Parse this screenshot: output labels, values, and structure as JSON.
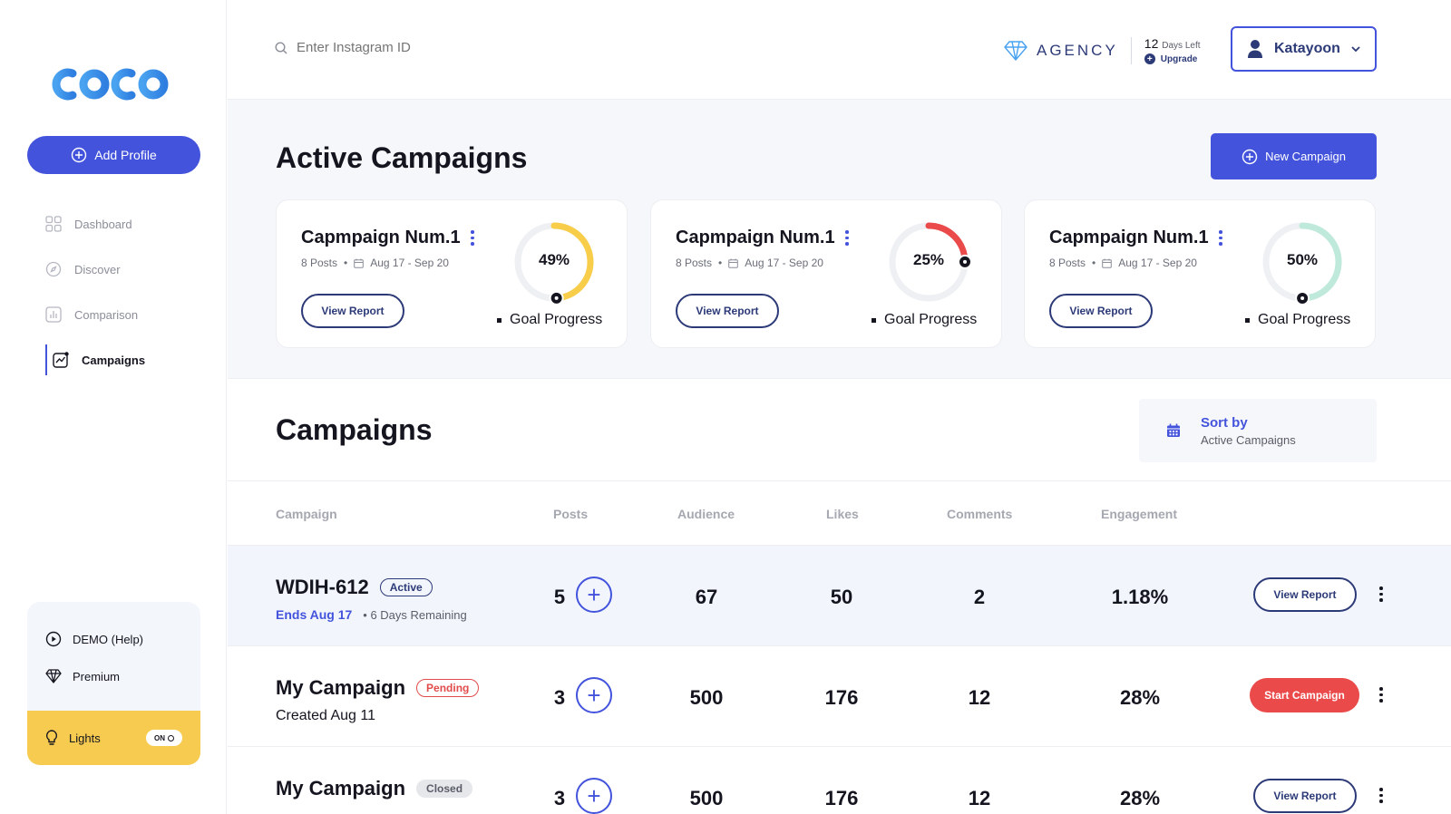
{
  "sidebar": {
    "add_profile_label": "Add Profile",
    "nav": [
      {
        "label": "Dashboard",
        "icon": "grid-icon"
      },
      {
        "label": "Discover",
        "icon": "compass-icon"
      },
      {
        "label": "Comparison",
        "icon": "bar-chart-icon"
      },
      {
        "label": "Campaigns",
        "icon": "campaign-chart-icon"
      }
    ],
    "help": {
      "demo_label": "DEMO (Help)",
      "premium_label": "Premium",
      "lights_label": "Lights",
      "toggle_label": "ON"
    }
  },
  "header": {
    "search_placeholder": "Enter Instagram ID",
    "agency_label": "AGENCY",
    "days_count": "12",
    "days_label": "Days Left",
    "upgrade_label": "Upgrade",
    "user_name": "Katayoon"
  },
  "active": {
    "title": "Active Campaigns",
    "new_campaign_label": "New Campaign",
    "cards": [
      {
        "title": "Capmpaign Num.1",
        "posts": "8 Posts",
        "dates": "Aug 17 - Sep 20",
        "view_label": "View Report",
        "percent_text": "49%",
        "progress": 0.49,
        "color": "#f7cd4a",
        "goal_label": "Goal Progress"
      },
      {
        "title": "Capmpaign Num.1",
        "posts": "8 Posts",
        "dates": "Aug 17 - Sep 20",
        "view_label": "View Report",
        "percent_text": "25%",
        "progress": 0.25,
        "color": "#ea4a4a",
        "goal_label": "Goal Progress"
      },
      {
        "title": "Capmpaign Num.1",
        "posts": "8 Posts",
        "dates": "Aug 17 - Sep 20",
        "view_label": "View Report",
        "percent_text": "50%",
        "progress": 0.5,
        "color": "#bfeadb",
        "goal_label": "Goal Progress"
      }
    ]
  },
  "campaigns": {
    "title": "Campaigns",
    "sort_title": "Sort by",
    "sort_value": "Active Campaigns",
    "columns": [
      "Campaign",
      "Posts",
      "Audience",
      "Likes",
      "Comments",
      "Engagement"
    ],
    "rows": [
      {
        "name": "WDIH-612",
        "status": "Active",
        "ends": "Ends Aug 17",
        "remaining": "6 Days Remaining",
        "posts": "5",
        "audience": "67",
        "likes": "50",
        "comments": "2",
        "engagement": "1.18%",
        "action": "View Report"
      },
      {
        "name": "My Campaign",
        "status": "Pending",
        "created": "Created Aug 11",
        "posts": "3",
        "audience": "500",
        "likes": "176",
        "comments": "12",
        "engagement": "28%",
        "action": "Start Campaign"
      },
      {
        "name": "My Campaign",
        "status": "Closed",
        "created": "",
        "posts": "3",
        "audience": "500",
        "likes": "176",
        "comments": "12",
        "engagement": "28%",
        "action": "View Report"
      }
    ]
  }
}
